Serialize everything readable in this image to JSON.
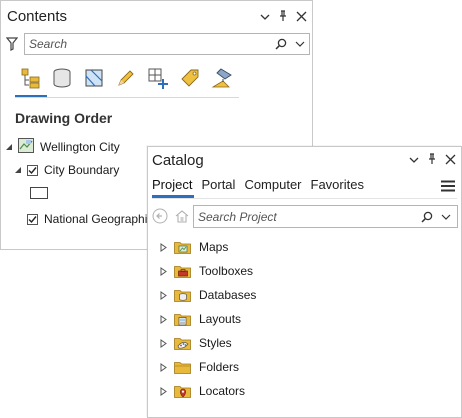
{
  "contents": {
    "title": "Contents",
    "search_placeholder": "Search",
    "section_heading": "Drawing Order",
    "map_name": "Wellington City",
    "layers": [
      {
        "name": "City Boundary",
        "checked": true
      },
      {
        "name": "National Geographic",
        "checked": true
      }
    ],
    "toolbar_icons": [
      "list-by-drawing-order-icon",
      "list-by-data-source-icon",
      "list-by-selection-icon",
      "list-by-editing-icon",
      "list-by-snapping-icon",
      "list-by-labeling-icon",
      "list-by-perspective-imagery-icon"
    ]
  },
  "catalog": {
    "title": "Catalog",
    "tabs": [
      "Project",
      "Portal",
      "Computer",
      "Favorites"
    ],
    "active_tab": "Project",
    "search_placeholder": "Search Project",
    "items": [
      {
        "label": "Maps",
        "icon": "maps-folder-icon"
      },
      {
        "label": "Toolboxes",
        "icon": "toolboxes-folder-icon"
      },
      {
        "label": "Databases",
        "icon": "databases-folder-icon"
      },
      {
        "label": "Layouts",
        "icon": "layouts-folder-icon"
      },
      {
        "label": "Styles",
        "icon": "styles-folder-icon"
      },
      {
        "label": "Folders",
        "icon": "folders-folder-icon"
      },
      {
        "label": "Locators",
        "icon": "locators-folder-icon"
      }
    ]
  },
  "colors": {
    "accent": "#2b6fbd",
    "folder": "#e8b93b",
    "border": "#c8c8c8"
  }
}
